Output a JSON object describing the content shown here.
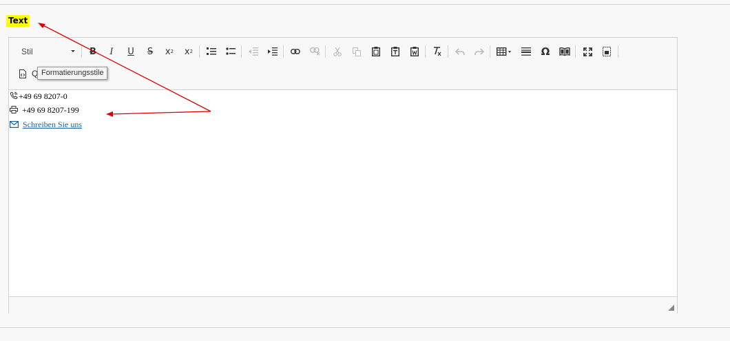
{
  "field": {
    "label": "Text",
    "label_bg": "#ffff00"
  },
  "toolbar": {
    "style_combo_label": "Stil",
    "tooltip": "Formatierungsstile",
    "row2_partial_label": "Q",
    "icons": {
      "bold": "B",
      "italic": "I",
      "underline": "U",
      "strike": "S",
      "subscript": "x",
      "superscript": "x",
      "omega": "Ω"
    }
  },
  "content": {
    "phone": "+49 69 8207-0",
    "fax": "+49 69 8207-199",
    "email_link": "Schreiben Sie uns"
  },
  "colors": {
    "arrow": "#e00000",
    "link": "#1a5f9c"
  }
}
